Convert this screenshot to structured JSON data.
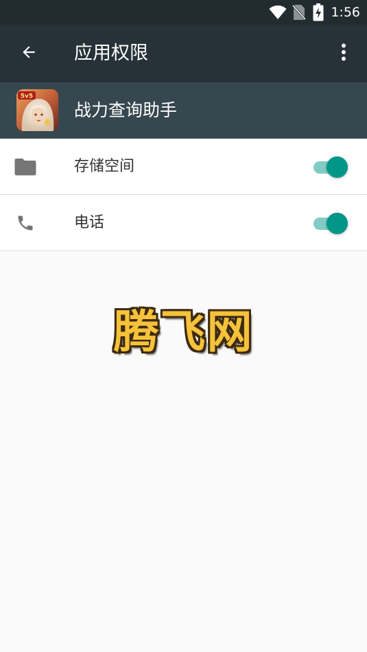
{
  "status_bar": {
    "time": "1:56",
    "icons": [
      "wifi-icon",
      "no-sim-icon",
      "battery-charging-icon"
    ]
  },
  "app_bar": {
    "title": "应用权限",
    "back_icon": "arrow-back-icon",
    "more_icon": "more-vert-icon"
  },
  "app_header": {
    "app_name": "战力查询助手",
    "app_icon": "game-app-icon"
  },
  "permissions": [
    {
      "label": "存储空间",
      "icon": "folder-icon",
      "enabled": true
    },
    {
      "label": "电话",
      "icon": "phone-icon",
      "enabled": true
    }
  ],
  "watermark": "腾飞网",
  "colors": {
    "status_bar_bg": "#222b30",
    "app_bar_bg": "#263238",
    "app_header_bg": "#37474f",
    "toggle_on_thumb": "#009688",
    "toggle_on_track": "#80cbc4",
    "watermark_fill": "#f5c23a"
  }
}
